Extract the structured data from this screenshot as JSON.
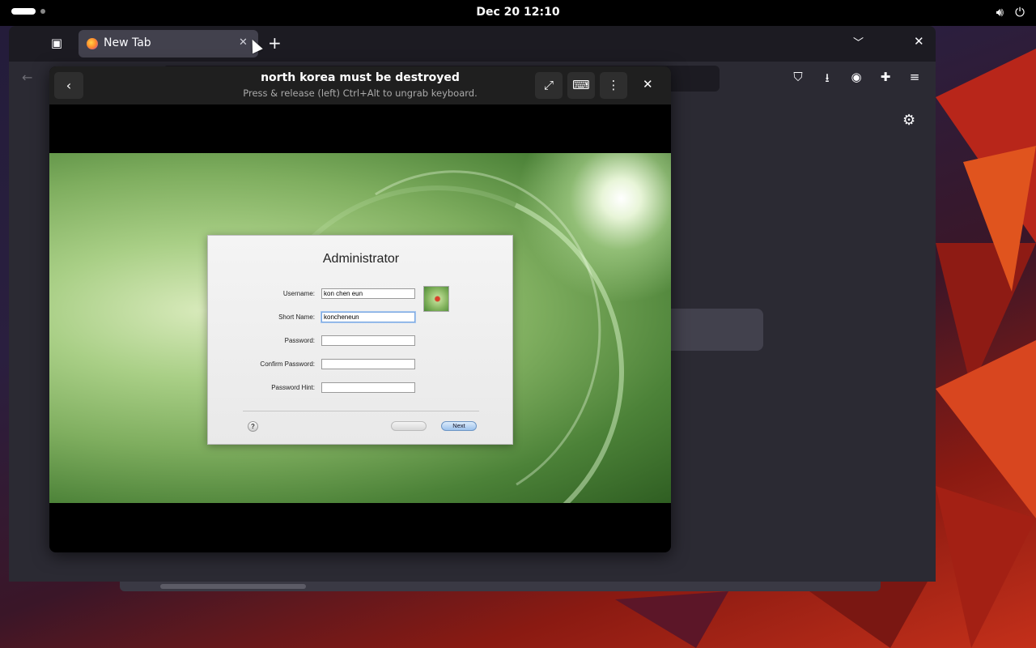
{
  "topbar": {
    "clock": "Dec 20  12:10",
    "icons": [
      "volume-icon",
      "power-icon"
    ]
  },
  "browser": {
    "tab": {
      "title": "New Tab",
      "close": "✕"
    },
    "new_tab": "+",
    "window_close": "✕",
    "nav_icons": [
      "pocket-icon",
      "downloads-icon",
      "account-icon",
      "extensions-icon",
      "menu-icon"
    ]
  },
  "viewer": {
    "title": "north korea must be destroyed",
    "subtitle": "Press & release (left) Ctrl+Alt to ungrab keyboard.",
    "buttons": [
      "back-icon",
      "fullscreen-icon",
      "keyboard-icon",
      "more-icon",
      "close-icon"
    ]
  },
  "setup": {
    "title": "Administrator",
    "fields": [
      {
        "label": "Username:",
        "value": "kon chen eun"
      },
      {
        "label": "Short Name:",
        "value": "koncheneun"
      },
      {
        "label": "Password:",
        "value": ""
      },
      {
        "label": "Confirm Password:",
        "value": ""
      },
      {
        "label": "Password Hint:",
        "value": ""
      }
    ],
    "help_label": "?",
    "back_label": "",
    "next_label": "Next"
  },
  "colors": {
    "accent_focus": "#7aa7e0",
    "browser_bg": "#2b2a33",
    "viewer_header": "#1f1f1f"
  }
}
